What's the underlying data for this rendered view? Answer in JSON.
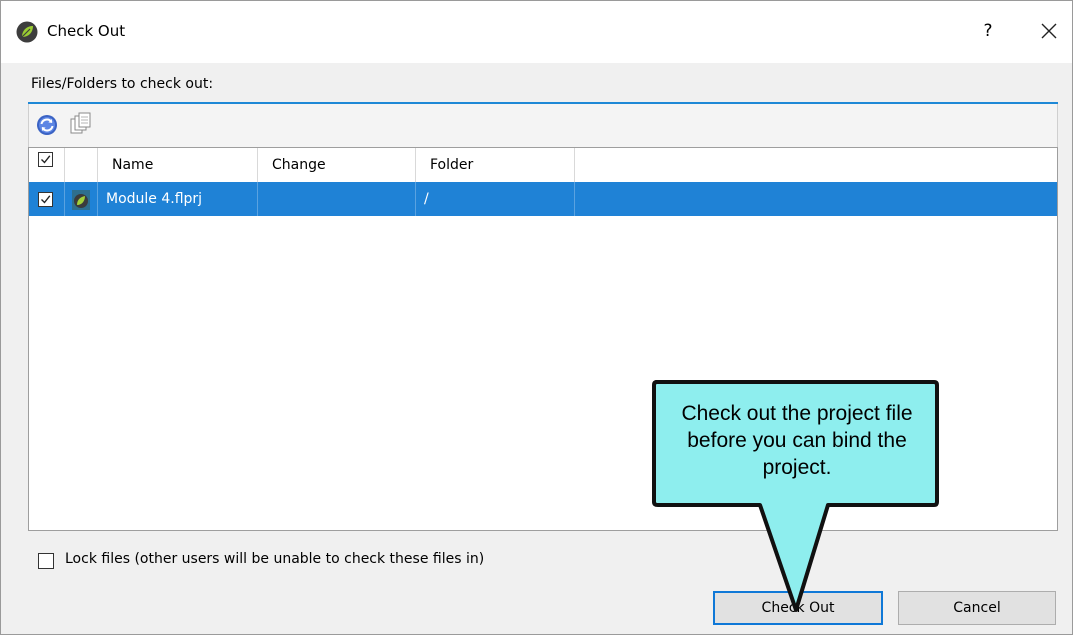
{
  "window": {
    "title": "Check Out",
    "help_label": "?",
    "app_icon": "flare-leaf-icon",
    "close_icon": "close-icon"
  },
  "section_label": "Files/Folders to check out:",
  "toolbar": {
    "icons": [
      "refresh-icon",
      "copy-icon"
    ]
  },
  "table": {
    "columns": [
      "Name",
      "Change",
      "Folder"
    ],
    "header_checked": true,
    "rows": [
      {
        "checked": true,
        "icon": "flare-project-icon",
        "name": "Module 4.flprj",
        "change": "",
        "folder": "/",
        "selected": true
      }
    ]
  },
  "lock_files": {
    "label": "Lock files (other users will be unable to check these files in)",
    "checked": false
  },
  "buttons": {
    "check_out": "Check Out",
    "cancel": "Cancel"
  },
  "callout": {
    "text": "Check out the project file before you can bind the project."
  },
  "colors": {
    "selection": "#1f82d6",
    "callout_fill": "#8eeeee",
    "accent": "#0f78d7"
  }
}
